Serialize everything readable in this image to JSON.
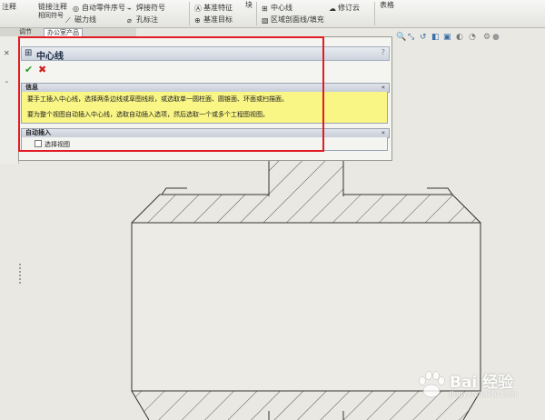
{
  "ribbon": {
    "items": [
      {
        "label": "注释"
      },
      {
        "label": "链接注释"
      },
      {
        "label": "相同符号"
      },
      {
        "label": "自动零件序号"
      },
      {
        "label": "磁力线"
      },
      {
        "label": "焊接符号"
      },
      {
        "label": "孔标注"
      },
      {
        "label": "基准特征"
      },
      {
        "label": "基准目标"
      },
      {
        "label": "块"
      },
      {
        "label": "中心线"
      },
      {
        "label": "区域剖面线/填充"
      },
      {
        "label": "修订云"
      },
      {
        "label": "表格"
      }
    ]
  },
  "tabs": [
    {
      "label": "调节"
    },
    {
      "label": "办公室产品"
    }
  ],
  "panel": {
    "title": "中心线",
    "help": "?",
    "ok": "✔",
    "cancel": "✖",
    "info": {
      "heading": "信息",
      "line1": "要手工插入中心线，选择两条边线或草图线段，或选取单一圆柱面、圆锥面、环面或扫描面。",
      "line2": "要为整个视图自动插入中心线，选取自动插入选项，然后选取一个或多个工程图视图。"
    },
    "auto": {
      "heading": "自动插入",
      "option": "选择视图"
    },
    "collapse": "«"
  },
  "watermark": {
    "brand": "Bai 经验",
    "url": "jingyan.baidu.com"
  },
  "colors": {
    "highlight": "#e21b24",
    "info_background": "#f9f685",
    "ok": "#2e9b2e",
    "cancel": "#d0211f"
  }
}
